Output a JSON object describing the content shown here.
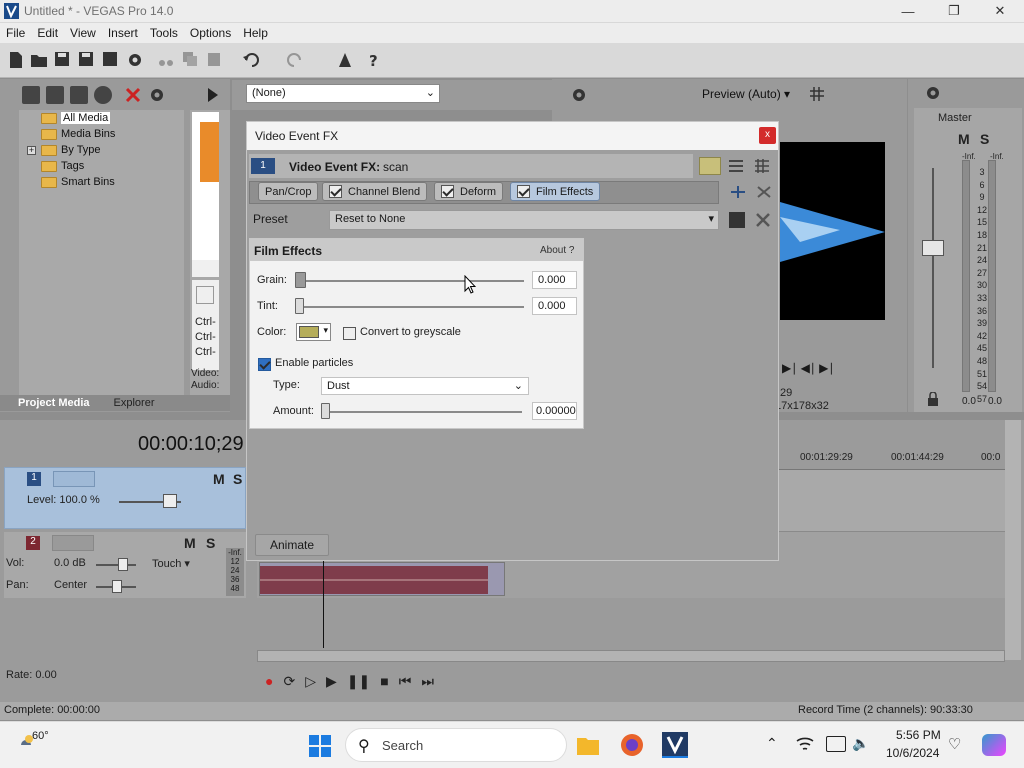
{
  "window": {
    "title": "Untitled * - VEGAS Pro 14.0",
    "controls": [
      "minimize",
      "restore",
      "close"
    ]
  },
  "menu": [
    "File",
    "Edit",
    "View",
    "Insert",
    "Tools",
    "Options",
    "Help"
  ],
  "project_media": {
    "tree": [
      "All Media",
      "Media Bins",
      "By Type",
      "Tags",
      "Smart Bins"
    ],
    "tabs": [
      "Project Media",
      "Explorer"
    ],
    "shortcuts": [
      "Ctrl-",
      "Ctrl-",
      "Ctrl-"
    ],
    "info": [
      "Video:",
      "Audio:"
    ]
  },
  "preview": {
    "filter_select": "(None)",
    "quality": "Preview (Auto)",
    "res": "17x178x32",
    "frame": "29"
  },
  "master": {
    "label": "Master",
    "meter_labels": [
      "-Inf.",
      "-Inf.",
      "3",
      "6",
      "9",
      "12",
      "15",
      "18",
      "21",
      "24",
      "27",
      "30",
      "33",
      "36",
      "39",
      "42",
      "45",
      "48",
      "51",
      "54",
      "57"
    ],
    "left_val": "0.0",
    "right_val": "0.0"
  },
  "timecode": "00:00:10;29",
  "ruler": [
    "00:01:29:29",
    "00:01:44:29",
    "00:0"
  ],
  "track1": {
    "num": "1",
    "level": "Level: 100.0 %"
  },
  "track2": {
    "num": "2",
    "vol_label": "Vol:",
    "vol": "0.0 dB",
    "pan_label": "Pan:",
    "pan": "Center",
    "touch": "Touch",
    "meter": [
      "-Inf.",
      "12",
      "24",
      "36",
      "48"
    ]
  },
  "rate": "Rate: 0.00",
  "status": {
    "complete": "Complete: 00:00:00",
    "record": "Record Time (2 channels): 90:33:30"
  },
  "dialog": {
    "title": "Video Event FX",
    "close": "x",
    "track_num": "1",
    "chain_label": "Video Event FX:",
    "chain_name": "scan",
    "chain": [
      "Pan/Crop",
      "Channel Blend",
      "Deform",
      "Film Effects"
    ],
    "preset_label": "Preset",
    "preset_value": "Reset to None",
    "plugin": {
      "name": "Film Effects",
      "about": "About",
      "about_q": "?",
      "grain_label": "Grain:",
      "grain": "0.000",
      "tint_label": "Tint:",
      "tint": "0.000",
      "color_label": "Color:",
      "color": "#b5ad5a",
      "greyscale_label": "Convert to greyscale",
      "particles_label": "Enable particles",
      "type_label": "Type:",
      "type": "Dust",
      "amount_label": "Amount:",
      "amount": "0.00000"
    },
    "animate": "Animate"
  },
  "taskbar": {
    "weather": "60°",
    "search": "Search",
    "time": "5:56 PM",
    "date": "10/6/2024"
  }
}
